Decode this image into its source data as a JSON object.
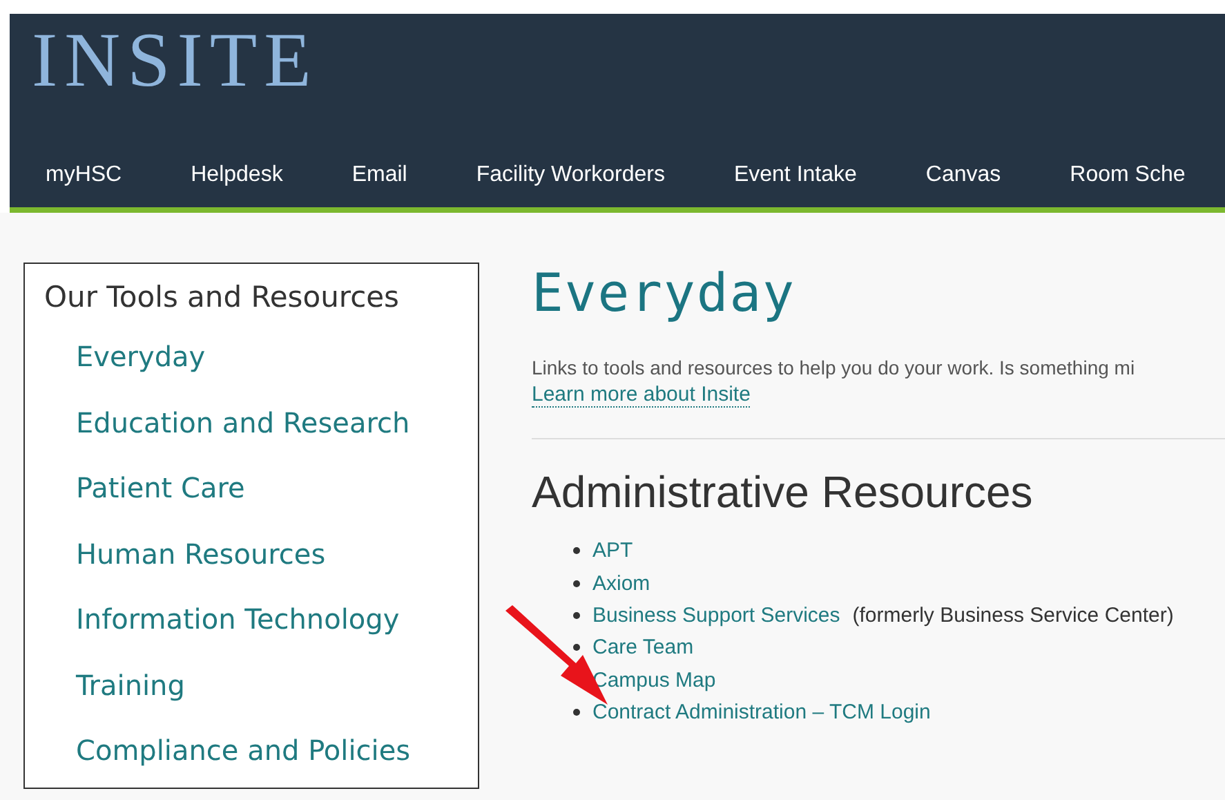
{
  "header": {
    "logo": "INSITE",
    "nav": [
      {
        "label": "myHSC"
      },
      {
        "label": "Helpdesk"
      },
      {
        "label": "Email"
      },
      {
        "label": "Facility Workorders"
      },
      {
        "label": "Event Intake"
      },
      {
        "label": "Canvas"
      },
      {
        "label": "Room Sche"
      }
    ]
  },
  "sidebar": {
    "title": "Our Tools and Resources",
    "items": [
      {
        "label": "Everyday"
      },
      {
        "label": "Education and Research"
      },
      {
        "label": "Patient Care"
      },
      {
        "label": "Human Resources"
      },
      {
        "label": "Information Technology"
      },
      {
        "label": "Training"
      },
      {
        "label": "Compliance and Policies"
      }
    ]
  },
  "main": {
    "title": "Everyday",
    "intro": "Links to tools and resources to help you do your work. Is something mi",
    "intro_link": "Learn more about Insite",
    "section_title": "Administrative Resources",
    "links": [
      {
        "label": "APT"
      },
      {
        "label": "Axiom"
      },
      {
        "label": "Business Support Services",
        "note": "(formerly Business Service Center)"
      },
      {
        "label": "Care Team"
      },
      {
        "label": "Campus Map"
      },
      {
        "label": "Contract Administration – TCM Login"
      }
    ]
  }
}
